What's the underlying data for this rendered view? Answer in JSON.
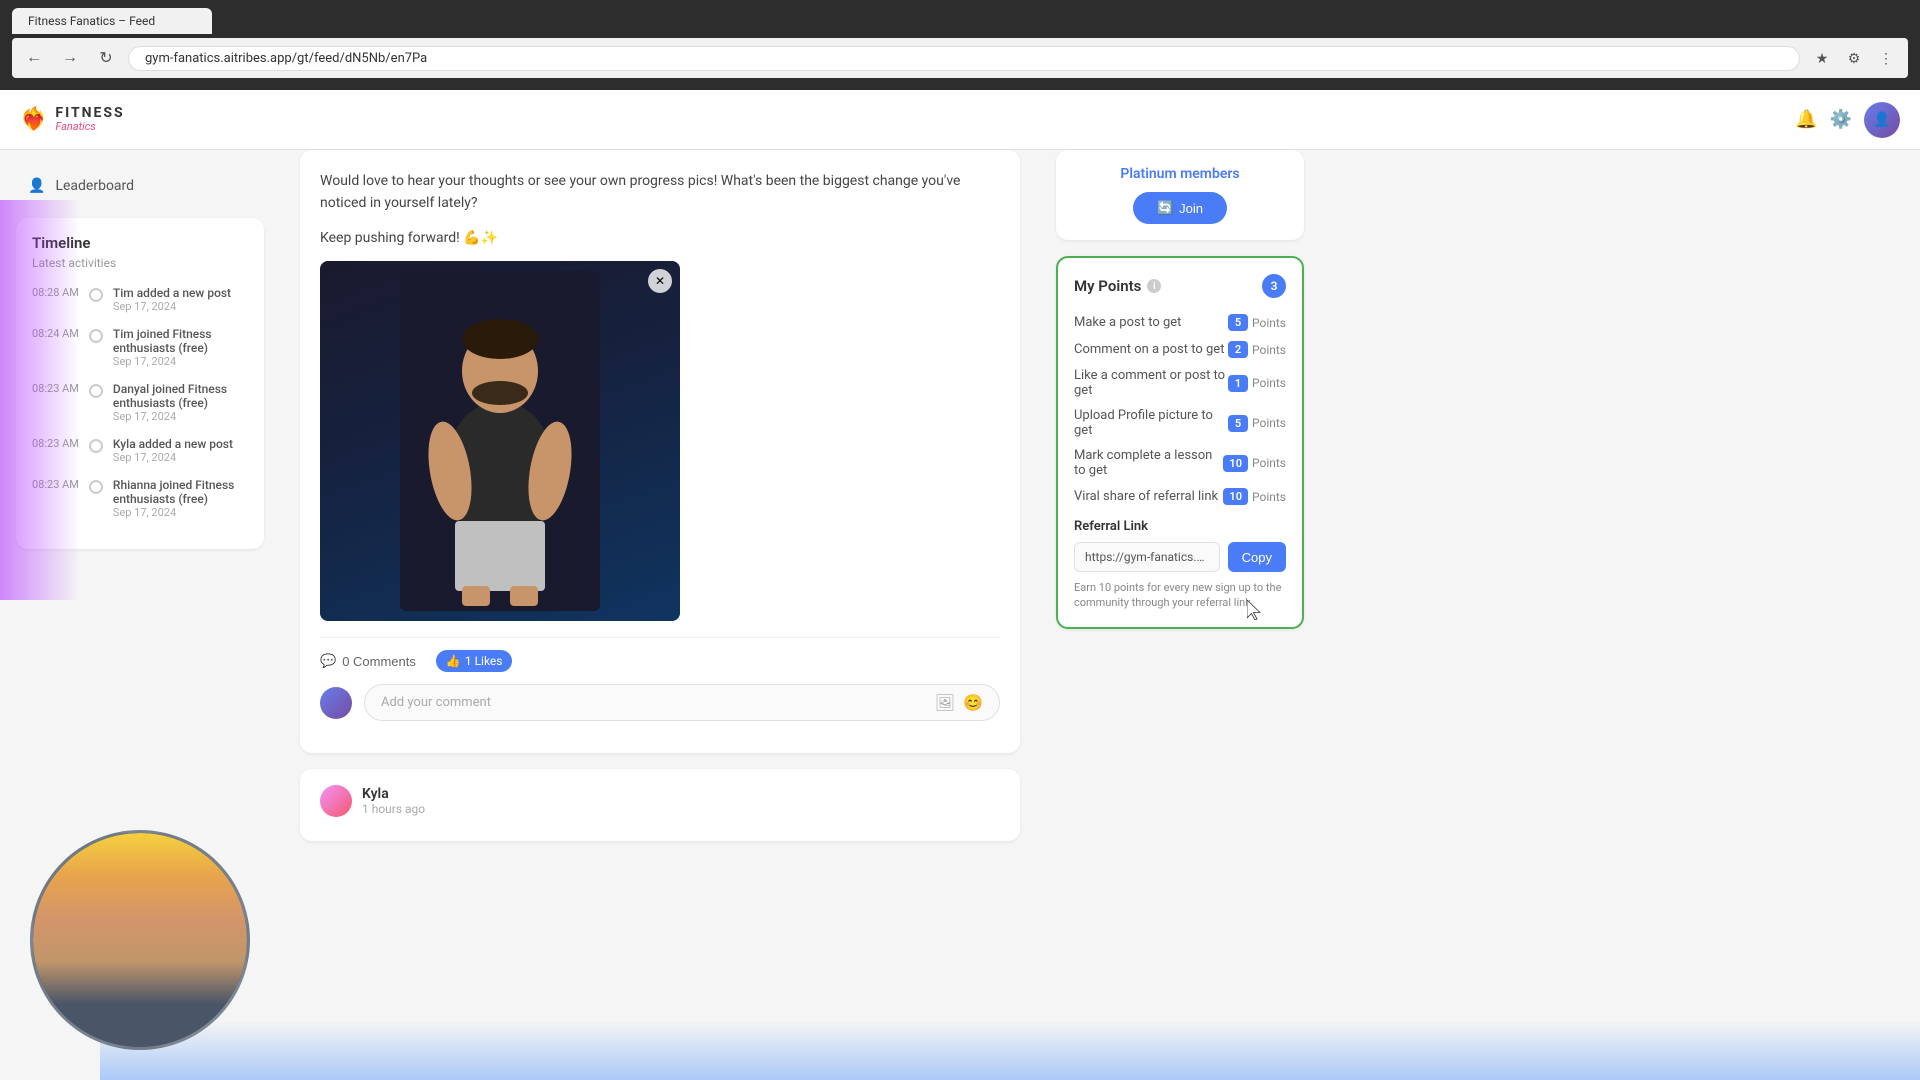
{
  "browser": {
    "url": "gym-fanatics.aitribes.app/gt/feed/dN5Nb/en7Pa",
    "tab_label": "Fitness Fanatics – Feed"
  },
  "header": {
    "logo_title": "FITNESS",
    "logo_subtitle": "Fanatics",
    "address_bar": "gym-fanatics.aitribes.app/gt/feed/dN5Nb/en7Pa"
  },
  "sidebar_left": {
    "nav_items": [
      {
        "icon": "👤",
        "label": "Leaderboard"
      }
    ],
    "timeline": {
      "title": "Timeline",
      "subtitle": "Latest activities",
      "items": [
        {
          "time": "08:28 AM",
          "action": "Tim added a new post",
          "date": "Sep 17, 2024"
        },
        {
          "time": "08:24 AM",
          "action": "Tim joined Fitness enthusiasts (free)",
          "date": "Sep 17, 2024"
        },
        {
          "time": "08:23 AM",
          "action": "Danyal joined Fitness enthusiasts (free)",
          "date": "Sep 17, 2024"
        },
        {
          "time": "08:23 AM",
          "action": "Kyla added a new post",
          "date": "Sep 17, 2024"
        },
        {
          "time": "08:23 AM",
          "action": "Rhianna joined Fitness enthusiasts (free)",
          "date": "Sep 17, 2024"
        }
      ]
    }
  },
  "post": {
    "text_line1": "Would love to hear your thoughts or see your own progress pics! What's been the biggest change you've noticed in yourself lately?",
    "text_line2": "Keep pushing forward! 💪✨",
    "comments_count": "0 Comments",
    "likes_count": "1 Likes",
    "comment_placeholder": "Add your comment",
    "next_post_author": "Kyla",
    "next_post_time": "1 hours ago"
  },
  "right_sidebar": {
    "platinum": {
      "title": "Platinum members",
      "join_btn": "Join"
    },
    "my_points": {
      "title": "My Points",
      "badge": "3",
      "rows": [
        {
          "action": "Make a post to get",
          "points": "5",
          "label": "Points"
        },
        {
          "action": "Comment on a post to get",
          "points": "2",
          "label": "Points"
        },
        {
          "action": "Like a comment or post to get",
          "points": "1",
          "label": "Points"
        },
        {
          "action": "Upload Profile picture to get",
          "points": "5",
          "label": "Points"
        },
        {
          "action": "Mark complete a lesson to get",
          "points": "10",
          "label": "Points"
        },
        {
          "action": "Viral share of referral link",
          "points": "10",
          "label": "Points"
        }
      ],
      "referral_section": {
        "title": "Referral Link",
        "link_value": "https://gym-fanatics.aitribes.app/ft/c",
        "copy_btn": "Copy",
        "note": "Earn 10 points for every new sign up to the community through your referral link"
      }
    }
  }
}
